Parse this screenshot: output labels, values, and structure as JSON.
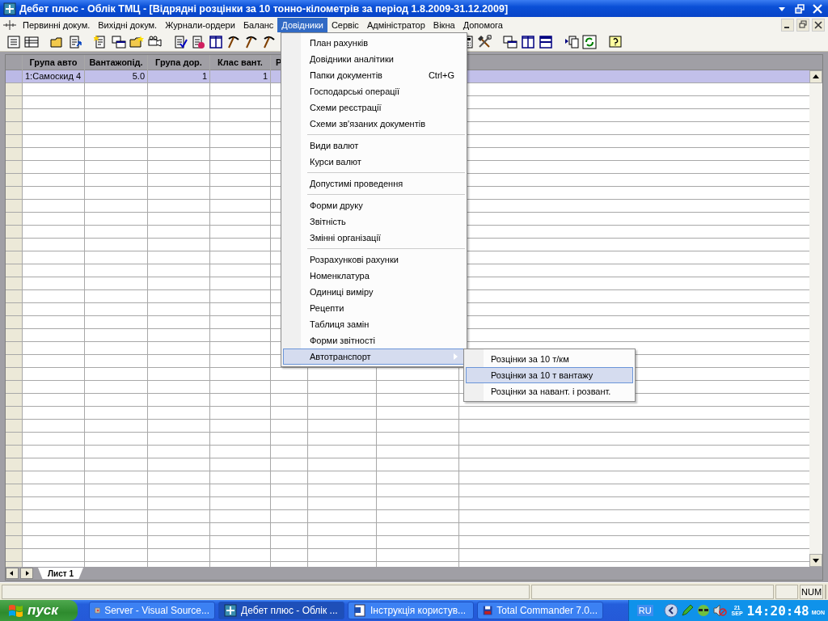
{
  "window": {
    "title": "Дебет плюс - Облік ТМЦ - [Відрядні розцінки за 10 тонно-кілометрів за період 1.8.2009-31.12.2009]"
  },
  "menu_bar": [
    {
      "label": "Первинні докум.",
      "selected": false
    },
    {
      "label": "Вихідні докум.",
      "selected": false
    },
    {
      "label": "Журнали-ордери",
      "selected": false
    },
    {
      "label": "Баланс",
      "selected": false
    },
    {
      "label": "Довідники",
      "selected": true
    },
    {
      "label": "Сервіс",
      "selected": false
    },
    {
      "label": "Адміністратор",
      "selected": false
    },
    {
      "label": "Вікна",
      "selected": false
    },
    {
      "label": "Допомога",
      "selected": false
    }
  ],
  "table": {
    "columns": [
      "Група авто",
      "Вантажопід.",
      "Група дор.",
      "Клас вант.",
      "Р"
    ],
    "rows": [
      {
        "selected": true,
        "cells": [
          "1:Самоскид 4",
          "5.0",
          "1",
          "1"
        ]
      }
    ]
  },
  "sheet_tabs": [
    {
      "label": "Лист 1",
      "selected": true
    }
  ],
  "dropdown_menu": {
    "groups": [
      [
        {
          "label": "План рахунків",
          "selected": false
        },
        {
          "label": "Довідники аналітики",
          "selected": false
        },
        {
          "label": "Папки документів",
          "shortcut": "Ctrl+G",
          "selected": false
        },
        {
          "label": "Господарські операції",
          "selected": false
        },
        {
          "label": "Схеми реєстрації",
          "selected": false
        },
        {
          "label": "Схеми зв'язаних документів",
          "selected": false
        }
      ],
      [
        {
          "label": "Види валют",
          "selected": false
        },
        {
          "label": "Курси валют",
          "selected": false
        }
      ],
      [
        {
          "label": "Допустимі проведення",
          "selected": false
        }
      ],
      [
        {
          "label": "Форми друку",
          "selected": false
        },
        {
          "label": "Звітність",
          "selected": false
        },
        {
          "label": "Змінні організації",
          "selected": false
        }
      ],
      [
        {
          "label": "Розрахункові рахунки",
          "selected": false
        },
        {
          "label": "Номенклатура",
          "selected": false
        },
        {
          "label": "Одиниці виміру",
          "selected": false
        },
        {
          "label": "Рецепти",
          "selected": false
        },
        {
          "label": "Таблиця замін",
          "selected": false
        },
        {
          "label": "Форми звітності",
          "selected": false
        },
        {
          "label": "Автотранспорт",
          "selected": true
        }
      ]
    ]
  },
  "submenu": [
    {
      "label": "Розцінки за 10 т/км",
      "selected": false
    },
    {
      "label": "Розцінки за 10 т вантажу",
      "selected": true
    },
    {
      "label": "Розцінки за навант. і розвант.",
      "selected": false
    }
  ],
  "status_bar": {
    "indicator": "NUM"
  },
  "taskbar": {
    "start": "пуск",
    "items": [
      {
        "label": "Server - Visual Source...",
        "selected": false
      },
      {
        "label": "Дебет плюс - Облік ...",
        "selected": true
      },
      {
        "label": "Інструкція користув...",
        "selected": false
      },
      {
        "label": "Total Commander 7.0...",
        "selected": false
      }
    ],
    "language": "RU",
    "date_day": "21",
    "date_month": "SEP",
    "clock": "14:20:48",
    "weekday": "MON"
  }
}
